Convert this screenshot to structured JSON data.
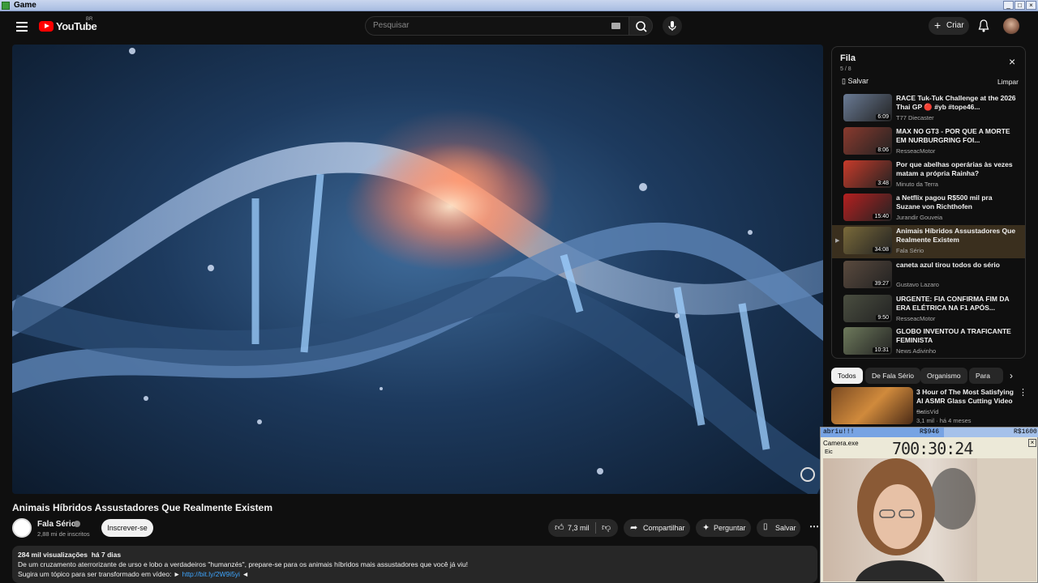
{
  "window": {
    "title": "Game"
  },
  "header": {
    "logo_text": "YouTube",
    "region": "BR",
    "search_placeholder": "Pesquisar",
    "create_label": "Criar"
  },
  "video": {
    "title": "Animais Híbridos Assustadores Que Realmente Existem",
    "channel": "Fala Sério",
    "subscribers": "2,88 mi de inscritos",
    "subscribe_label": "Inscrever-se",
    "likes": "7,3 mil",
    "share_label": "Compartilhar",
    "ask_label": "Perguntar",
    "save_label": "Salvar",
    "views": "284 mil visualizações",
    "age": "há 7 dias",
    "description_line1": "De um cruzamento aterrorizante de urso e lobo a verdadeiros \"humanzés\", prepare-se para os animais híbridos mais assustadores que você já viu!",
    "description_line2": "Sugira um tópico para ser transformado em vídeo: ►",
    "description_link": "http://bit.ly/2W9i5yi",
    "description_arrow": "◄"
  },
  "queue": {
    "title": "Fila",
    "position": "5 / 8",
    "save_label": "Salvar",
    "clear_label": "Limpar",
    "items": [
      {
        "title": "RACE Tuk-Tuk Challenge at the 2026 Thai GP 🔴 #yb #tope46...",
        "channel": "T77 Diecaster",
        "duration": "6:09",
        "color": "#6a7b95"
      },
      {
        "title": "MAX NO GT3 - POR QUE A MORTE EM NURBURGRING FOI...",
        "channel": "ResseacMotor",
        "duration": "8:06",
        "color": "#8a3a2e"
      },
      {
        "title": "Por que abelhas operárias às vezes matam a própria Rainha?",
        "channel": "Minuto da Terra",
        "duration": "3:48",
        "color": "#c83b2a"
      },
      {
        "title": "a Netflix pagou R$500 mil pra Suzane von Richthofen",
        "channel": "Jurandir Gouveia",
        "duration": "15:40",
        "color": "#b52020"
      },
      {
        "title": "Animais Híbridos Assustadores Que Realmente Existem",
        "channel": "Fala Sério",
        "duration": "34:08",
        "color": "#7a6a3a"
      },
      {
        "title": "caneta azul tirou todos do sério",
        "channel": "Gustavo Lazaro",
        "duration": "39:27",
        "color": "#5a4a3e"
      },
      {
        "title": "URGENTE: FIA CONFIRMA FIM DA ERA ELÉTRICA NA F1 APÓS...",
        "channel": "ResseacMotor",
        "duration": "9:50",
        "color": "#4a4e40"
      },
      {
        "title": "GLOBO INVENTOU A TRAFICANTE FEMINISTA",
        "channel": "News Adivinho",
        "duration": "10:31",
        "color": "#6e7a5c"
      }
    ]
  },
  "chips": [
    "Todos",
    "De Fala Sério",
    "Organismo",
    "Para vo"
  ],
  "recommended": {
    "title": "3 Hour of The Most Satisfying AI ASMR Glass Cutting Video ...",
    "channel": "SatisVid",
    "meta": "3,1 mil · há 4 meses"
  },
  "overlay": {
    "label": "abriu!!!",
    "value1": "R$946",
    "value2": "R$1600",
    "window_title": "Camera.exe",
    "window_sub": "Eic",
    "timer": "700:30:24"
  }
}
